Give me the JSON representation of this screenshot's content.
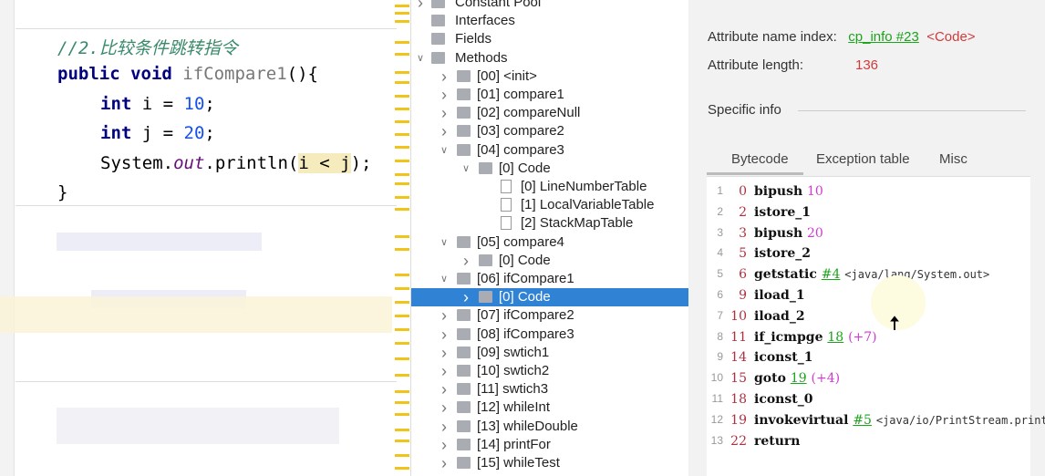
{
  "editor": {
    "comment": "//2.比较条件跳转指令",
    "sig_kw": "public void ",
    "sig_name": "ifCompare1",
    "sig_end": "(){",
    "line1_kw": "int",
    "line1_rest": " i = ",
    "line1_num": "10",
    "line2_kw": "int",
    "line2_rest": " j = ",
    "line2_num": "20",
    "line3_a": "System.",
    "line3_out": "out",
    "line3_b": ".println(",
    "line3_hl": "i < j",
    "line3_c": ");",
    "close": "}"
  },
  "tree": {
    "items": [
      {
        "label": "Constant Pool",
        "level": 0,
        "type": "folder",
        "chevron": "right"
      },
      {
        "label": "Interfaces",
        "level": 0,
        "type": "folder",
        "chevron": ""
      },
      {
        "label": "Fields",
        "level": 0,
        "type": "folder",
        "chevron": ""
      },
      {
        "label": "Methods",
        "level": 0,
        "type": "folder",
        "chevron": "down"
      },
      {
        "label": "[00] <init>",
        "level": 1,
        "type": "folder",
        "chevron": "right"
      },
      {
        "label": "[01] compare1",
        "level": 1,
        "type": "folder",
        "chevron": "right"
      },
      {
        "label": "[02] compareNull",
        "level": 1,
        "type": "folder",
        "chevron": "right"
      },
      {
        "label": "[03] compare2",
        "level": 1,
        "type": "folder",
        "chevron": "right"
      },
      {
        "label": "[04] compare3",
        "level": 1,
        "type": "folder",
        "chevron": "down"
      },
      {
        "label": "[0] Code",
        "level": 2,
        "type": "folder",
        "chevron": "down"
      },
      {
        "label": "[0] LineNumberTable",
        "level": 3,
        "type": "file",
        "chevron": ""
      },
      {
        "label": "[1] LocalVariableTable",
        "level": 3,
        "type": "file",
        "chevron": ""
      },
      {
        "label": "[2] StackMapTable",
        "level": 3,
        "type": "file",
        "chevron": ""
      },
      {
        "label": "[05] compare4",
        "level": 1,
        "type": "folder",
        "chevron": "down"
      },
      {
        "label": "[0] Code",
        "level": 2,
        "type": "folder",
        "chevron": "right"
      },
      {
        "label": "[06] ifCompare1",
        "level": 1,
        "type": "folder",
        "chevron": "down"
      },
      {
        "label": "[0] Code",
        "level": 2,
        "type": "folder",
        "chevron": "right",
        "selected": true
      },
      {
        "label": "[07] ifCompare2",
        "level": 1,
        "type": "folder",
        "chevron": "right"
      },
      {
        "label": "[08] ifCompare3",
        "level": 1,
        "type": "folder",
        "chevron": "right"
      },
      {
        "label": "[09] swtich1",
        "level": 1,
        "type": "folder",
        "chevron": "right"
      },
      {
        "label": "[10] swtich2",
        "level": 1,
        "type": "folder",
        "chevron": "right"
      },
      {
        "label": "[11] swtich3",
        "level": 1,
        "type": "folder",
        "chevron": "right"
      },
      {
        "label": "[12] whileInt",
        "level": 1,
        "type": "folder",
        "chevron": "right"
      },
      {
        "label": "[13] whileDouble",
        "level": 1,
        "type": "folder",
        "chevron": "right"
      },
      {
        "label": "[14] printFor",
        "level": 1,
        "type": "folder",
        "chevron": "right"
      },
      {
        "label": "[15] whileTest",
        "level": 1,
        "type": "folder",
        "chevron": "right"
      }
    ]
  },
  "info": {
    "name_index_label": "Attribute name index:",
    "name_index_link": "cp_info #23",
    "name_index_value": "<Code>",
    "length_label": "Attribute length:",
    "length_value": "136",
    "specific_info": "Specific info"
  },
  "tabs": [
    {
      "label": "Bytecode",
      "active": true
    },
    {
      "label": "Exception table"
    },
    {
      "label": "Misc"
    }
  ],
  "bytecode": [
    {
      "line": "1",
      "offset": "0",
      "op": "bipush",
      "arg": "10",
      "argType": "num"
    },
    {
      "line": "2",
      "offset": "2",
      "op": "istore_1"
    },
    {
      "line": "3",
      "offset": "3",
      "op": "bipush",
      "arg": "20",
      "argType": "num"
    },
    {
      "line": "4",
      "offset": "5",
      "op": "istore_2"
    },
    {
      "line": "5",
      "offset": "6",
      "op": "getstatic",
      "arg": "#4",
      "argType": "ref",
      "comment": "<java/lang/System.out>"
    },
    {
      "line": "6",
      "offset": "9",
      "op": "iload_1"
    },
    {
      "line": "7",
      "offset": "10",
      "op": "iload_2"
    },
    {
      "line": "8",
      "offset": "11",
      "op": "if_icmpge",
      "arg": "18",
      "argType": "ref",
      "comment": "(+7)",
      "commentType": "num"
    },
    {
      "line": "9",
      "offset": "14",
      "op": "iconst_1"
    },
    {
      "line": "10",
      "offset": "15",
      "op": "goto",
      "arg": "19",
      "argType": "ref",
      "comment": "(+4)",
      "commentType": "num"
    },
    {
      "line": "11",
      "offset": "18",
      "op": "iconst_0"
    },
    {
      "line": "12",
      "offset": "19",
      "op": "invokevirtual",
      "arg": "#5",
      "argType": "ref",
      "comment": "<java/io/PrintStream.print"
    },
    {
      "line": "13",
      "offset": "22",
      "op": "return"
    }
  ]
}
